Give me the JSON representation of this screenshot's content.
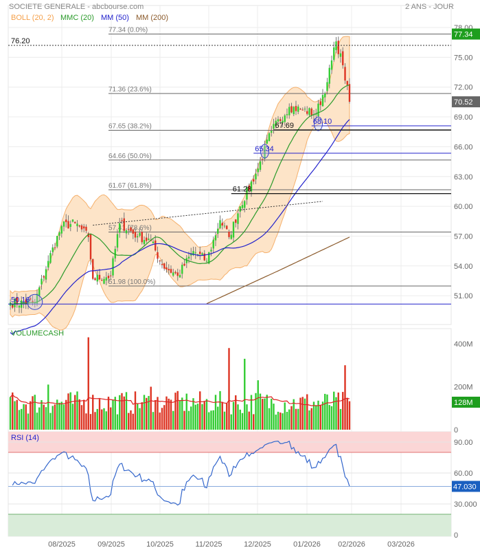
{
  "header": {
    "title": "SOCIETE GENERALE - abcbourse.com",
    "period": "2 ANS - JOUR"
  },
  "legend": [
    {
      "label": "BOLL (20, 2)",
      "color": "#f5a04a"
    },
    {
      "label": "MMC (20)",
      "color": "#2a9a2a"
    },
    {
      "label": "MM (50)",
      "color": "#2222cc"
    },
    {
      "label": "MM (200)",
      "color": "#8b5a2b"
    }
  ],
  "chart_data": {
    "type": "candlestick",
    "title": "SOCIETE GENERALE",
    "x_months": [
      "08/2025",
      "09/2025",
      "10/2025",
      "11/2025",
      "12/2025",
      "01/2026",
      "02/2026",
      "03/2026"
    ],
    "price_axis": {
      "ylim": [
        49.5,
        79
      ],
      "ticks": [
        "78.00",
        "75.00",
        "72.00",
        "69.00",
        "66.00",
        "63.00",
        "60.00",
        "57.00",
        "54.00",
        "51.00"
      ]
    },
    "close_keypoints": [
      [
        0,
        50.3
      ],
      [
        11,
        50.3
      ],
      [
        17,
        54.5
      ],
      [
        23,
        58
      ],
      [
        29,
        58.3
      ],
      [
        35,
        56.9
      ],
      [
        37,
        52.7
      ],
      [
        45,
        53
      ],
      [
        49,
        58.3
      ],
      [
        57,
        57
      ],
      [
        63,
        56.5
      ],
      [
        68,
        54.1
      ],
      [
        75,
        53
      ],
      [
        82,
        55.5
      ],
      [
        88,
        54.5
      ],
      [
        94,
        58.6
      ],
      [
        98,
        56.9
      ],
      [
        103,
        60
      ],
      [
        111,
        63.8
      ],
      [
        117,
        67.6
      ],
      [
        125,
        70
      ],
      [
        131,
        69.7
      ],
      [
        137,
        69.3
      ],
      [
        142,
        72.5
      ],
      [
        146,
        76.6
      ],
      [
        149,
        74.2
      ],
      [
        152,
        70.52
      ]
    ],
    "mm200_keypoints": [
      [
        88,
        50.2
      ],
      [
        120,
        53.5
      ],
      [
        152,
        56.9
      ]
    ],
    "last_price": "70.52",
    "high_label": "77.34",
    "fibonacci": [
      {
        "value": 77.34,
        "label": "77.34  (0.0%)"
      },
      {
        "value": 71.36,
        "label": "71.36  (23.6%)"
      },
      {
        "value": 67.65,
        "label": "67.65  (38.2%)"
      },
      {
        "value": 64.66,
        "label": "64.66  (50.0%)"
      },
      {
        "value": 61.67,
        "label": "61.67  (61.8%)"
      },
      {
        "value": 57.41,
        "label": "57.41  (78.6%)"
      },
      {
        "value": 51.98,
        "label": "51.98  (100.0%)"
      }
    ],
    "annotations": [
      {
        "value": 76.2,
        "label": "76.20",
        "style": "dotted",
        "from": 0
      },
      {
        "value": 50.16,
        "label": "50.16",
        "style": "blue",
        "from": 0,
        "circle": 11
      },
      {
        "value": 65.34,
        "label": "65.34",
        "style": "blue",
        "from": 109,
        "circle": 114
      },
      {
        "value": 68.1,
        "label": "68.10",
        "style": "blue",
        "from": 135,
        "circle": 138
      },
      {
        "value": 67.69,
        "label": "67.69",
        "style": "black",
        "from": 118
      },
      {
        "value": 61.28,
        "label": "61.28",
        "style": "black",
        "from": 99
      }
    ],
    "trendline": [
      [
        37,
        58.1
      ],
      [
        140,
        60.5
      ]
    ],
    "volume": {
      "title": "VOLUMECASH",
      "ticks": [
        "400M",
        "200M",
        "0"
      ],
      "last": "128M",
      "spikes": [
        [
          17,
          210
        ],
        [
          35,
          430
        ],
        [
          63,
          200
        ],
        [
          98,
          380
        ],
        [
          105,
          330
        ],
        [
          111,
          230
        ],
        [
          150,
          300
        ]
      ]
    },
    "rsi": {
      "title": "RSI (14)",
      "ticks": [
        "90.00",
        "60.00",
        "30.000",
        "0"
      ],
      "last": "47.030",
      "overbought": 80,
      "oversold": 20
    }
  }
}
